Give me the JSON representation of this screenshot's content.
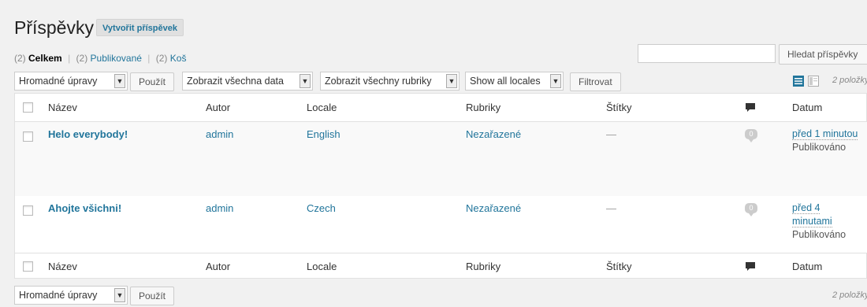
{
  "page": {
    "title": "Příspěvky",
    "add_new": "Vytvořit příspěvek"
  },
  "filters": {
    "all_count": "(2)",
    "all_label": "Celkem",
    "published_count": "(2)",
    "published_label": "Publikované",
    "trash_count": "(2)",
    "trash_label": "Koš",
    "sep": "|"
  },
  "search": {
    "value": "",
    "button": "Hledat příspěvky"
  },
  "bulk": {
    "selected": "Hromadné úpravy",
    "apply": "Použít"
  },
  "dates_filter": {
    "selected": "Zobrazit všechna data"
  },
  "category_filter": {
    "selected": "Zobrazit všechny rubriky"
  },
  "locale_filter": {
    "selected": "Show all locales"
  },
  "filter_button": "Filtrovat",
  "items_count": "2 položky",
  "columns": {
    "title": "Název",
    "author": "Autor",
    "locale": "Locale",
    "categories": "Rubriky",
    "tags": "Štítky",
    "date": "Datum"
  },
  "posts": [
    {
      "title": "Helo everybody!",
      "author": "admin",
      "locale": "English",
      "category": "Nezařazené",
      "tags": "—",
      "comments": "0",
      "date_lines": [
        "před 1 minutou"
      ],
      "status": "Publikováno"
    },
    {
      "title": "Ahojte všichni!",
      "author": "admin",
      "locale": "Czech",
      "category": "Nezařazené",
      "tags": "—",
      "comments": "0",
      "date_lines": [
        "před 4",
        "minutami"
      ],
      "status": "Publikováno"
    }
  ],
  "colors": {
    "link": "#21759b",
    "background": "#f1f1f1",
    "view_active": "#21759b"
  },
  "icons": {
    "comments_header": "comment-icon",
    "view_list": "list-view-icon",
    "view_excerpt": "excerpt-view-icon"
  }
}
